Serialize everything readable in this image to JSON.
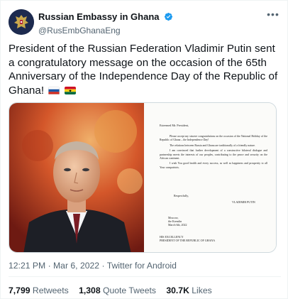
{
  "account": {
    "display_name": "Russian Embassy in Ghana",
    "handle": "@RusEmbGhanaEng"
  },
  "tweet": {
    "text": "President of the Russian Federation Vladimir Putin sent a congratulatory message on the occasion of the 65th Anniversary of the Independence Day of the Republic of Ghana!"
  },
  "letter": {
    "salutation": "Esteemed Mr. President,",
    "paragraphs": [
      "Please accept my sincere congratulations on the occasion of the National Holiday of the Republic of Ghana – the Independence Day!",
      "The relations between Russia and Ghana are traditionally of a friendly nature.",
      "I am convinced that further development of a constructive bilateral dialogue and partnership meets the interests of our peoples, contributing to the peace and security on the African continent.",
      "I wish You good health and every success, as well as happiness and prosperity to all Your compatriots."
    ],
    "closing": "Respectfully,",
    "signature": "VLADIMIR PUTIN",
    "place_lines": [
      "Moscow,",
      "the Kremlin",
      "March 6th, 2022"
    ],
    "addressee_lines": [
      "HIS EXCELLENCY",
      "PRESIDENT OF THE REPUBLIC OF GHANA"
    ]
  },
  "meta": {
    "time": "12:21 PM",
    "date": "Mar 6, 2022",
    "source": "Twitter for Android"
  },
  "stats": {
    "retweets_count": "7,799",
    "retweets_label": "Retweets",
    "quote_count": "1,308",
    "quote_label": "Quote Tweets",
    "likes_count": "30.7K",
    "likes_label": "Likes"
  },
  "icons": {
    "verified": "verified-badge-icon",
    "more": "more-options-icon",
    "flag_russia": "russia-flag-icon",
    "flag_ghana": "ghana-flag-icon"
  },
  "colors": {
    "text": "#0f1419",
    "secondary": "#536471",
    "verified": "#1d9bf0",
    "border": "#cfd9de"
  }
}
